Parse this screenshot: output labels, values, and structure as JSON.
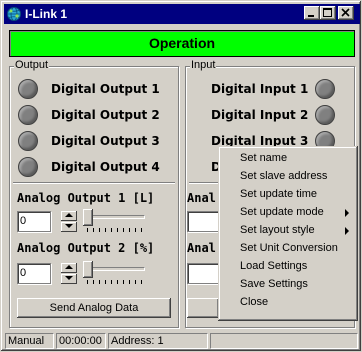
{
  "window": {
    "title": "I-Link 1",
    "title_icon": "network-globe-icon",
    "controls": [
      "minimize-icon",
      "maximize-icon",
      "close-icon"
    ]
  },
  "status_banner": {
    "text": "Operation",
    "color": "#00ff00"
  },
  "output_group": {
    "label": "Output",
    "digital_outputs": [
      {
        "label": "Digital Output 1",
        "led_color": "#808080"
      },
      {
        "label": "Digital Output 2",
        "led_color": "#808080"
      },
      {
        "label": "Digital Output 3",
        "led_color": "#808080"
      },
      {
        "label": "Digital Output 4",
        "led_color": "#808080"
      }
    ],
    "analog_outputs": [
      {
        "label": "Analog Output 1 [L]",
        "value": "0",
        "slider_level": 0
      },
      {
        "label": "Analog Output 2 [%]",
        "value": "0",
        "slider_level": 0
      }
    ],
    "send_button": "Send Analog Data"
  },
  "input_group": {
    "label": "Input",
    "digital_inputs": [
      {
        "label": "Digital Input 1",
        "led_color": "#808080"
      },
      {
        "label": "Digital Input 2",
        "led_color": "#808080"
      },
      {
        "label": "Digital Input 3",
        "led_color": "#808080"
      },
      {
        "label": "D",
        "led_color": "#808080"
      }
    ],
    "analog_inputs": [
      {
        "label": "Anal"
      },
      {
        "label": "Anal"
      }
    ]
  },
  "status_bar": {
    "mode": "Manual",
    "time": "00:00:00",
    "address": "Address: 1"
  },
  "context_menu": {
    "items": [
      {
        "label": "Set name",
        "submenu": false
      },
      {
        "label": "Set slave address",
        "submenu": false
      },
      {
        "label": "Set update time",
        "submenu": false
      },
      {
        "label": "Set update mode",
        "submenu": true
      },
      {
        "label": "Set layout style",
        "submenu": true
      },
      {
        "label": "Set Unit Conversion",
        "submenu": false
      },
      {
        "label": "Load Settings",
        "submenu": false
      },
      {
        "label": "Save Settings",
        "submenu": false
      },
      {
        "label": "Close",
        "submenu": false
      }
    ]
  }
}
